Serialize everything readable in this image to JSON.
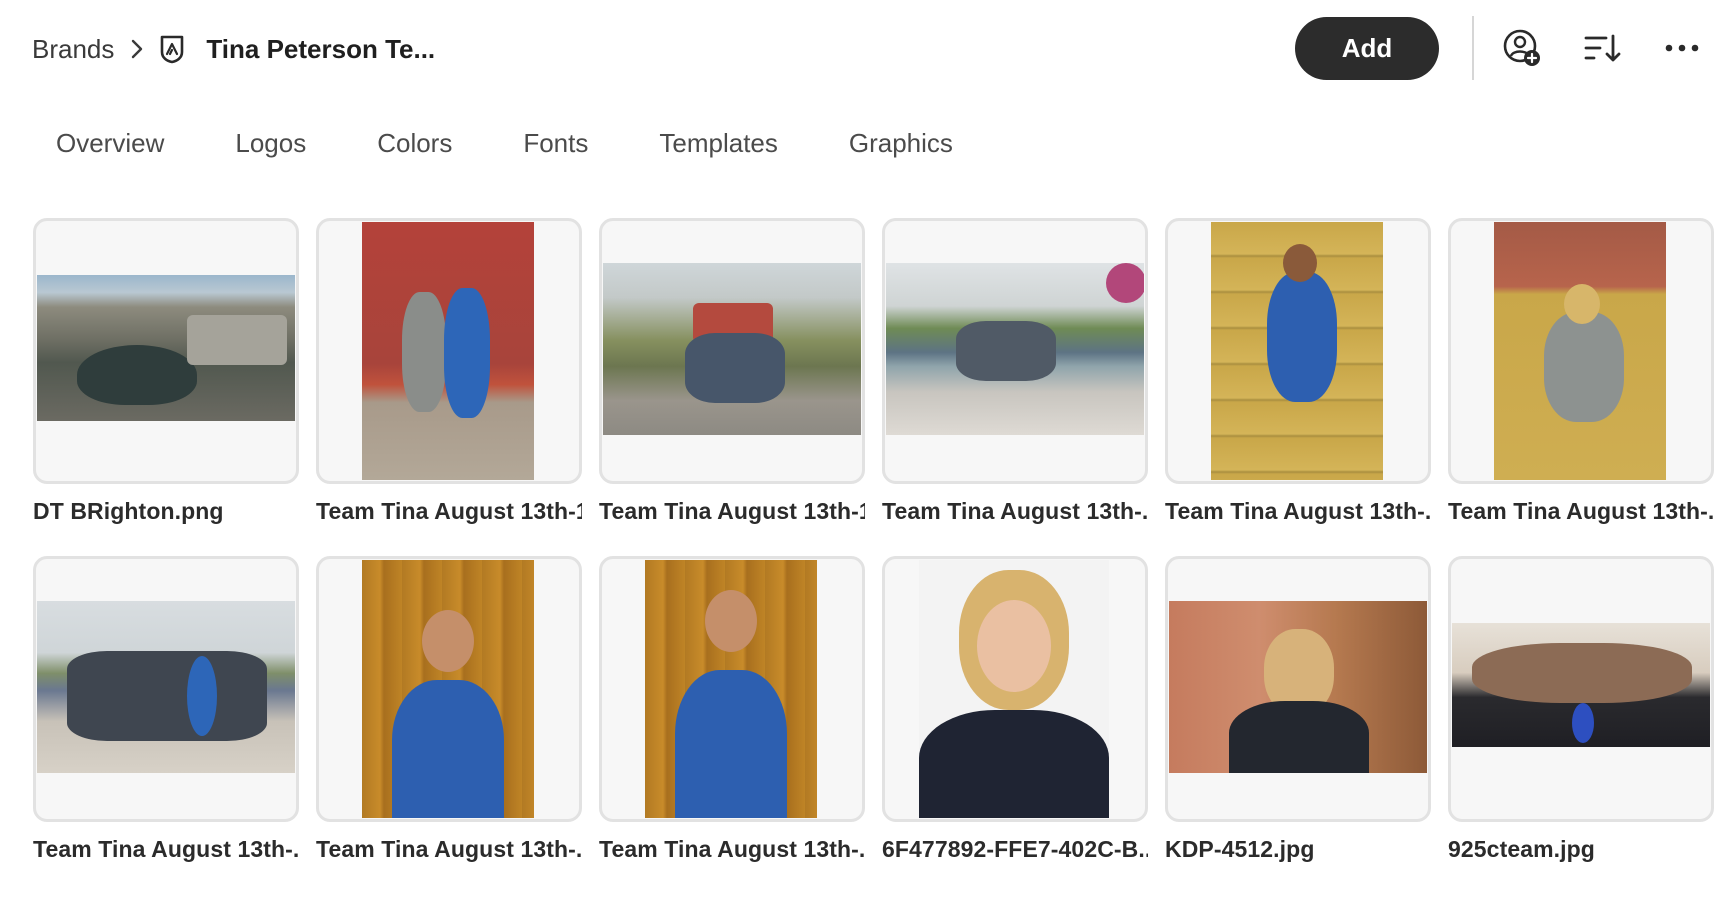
{
  "breadcrumb": {
    "root": "Brands",
    "current": "Tina Peterson Te..."
  },
  "header": {
    "add_label": "Add",
    "icons": [
      "chevron-right-icon",
      "brand-shield-icon",
      "user-add-icon",
      "sort-icon",
      "more-icon"
    ]
  },
  "tabs": [
    "Overview",
    "Logos",
    "Colors",
    "Fonts",
    "Templates",
    "Graphics"
  ],
  "assets": [
    {
      "name": "DT BRighton.png"
    },
    {
      "name": "Team Tina August 13th-1..."
    },
    {
      "name": "Team Tina August 13th-1..."
    },
    {
      "name": "Team Tina August 13th-..."
    },
    {
      "name": "Team Tina August 13th-..."
    },
    {
      "name": "Team Tina August 13th-..."
    },
    {
      "name": "Team Tina August 13th-..."
    },
    {
      "name": "Team Tina August 13th-..."
    },
    {
      "name": "Team Tina August 13th-..."
    },
    {
      "name": "6F477892-FFE7-402C-B..."
    },
    {
      "name": "KDP-4512.jpg"
    },
    {
      "name": "925cteam.jpg"
    }
  ],
  "colors": {
    "add_button": "#2c2c2c",
    "card_border": "#e2e2e2",
    "card_bg": "#f7f7f7"
  }
}
